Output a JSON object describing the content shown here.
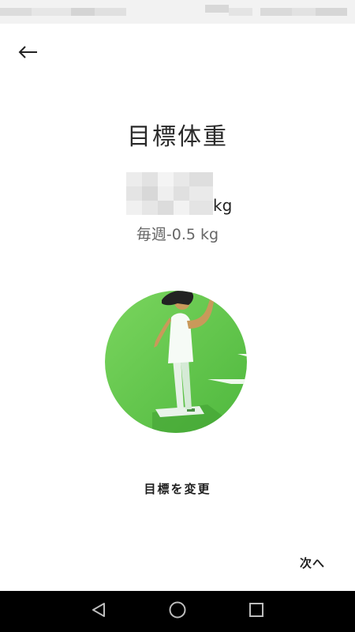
{
  "header": {
    "back_icon": "arrow-left-icon"
  },
  "main": {
    "title": "目標体重",
    "weight_value": "",
    "weight_unit": "kg",
    "weekly_rate": "毎週-0.5 kg",
    "illustration_icon": "woman-on-scale-illustration",
    "change_goal_label": "目標を変更",
    "next_label": "次へ"
  },
  "navigation": {
    "back_icon": "nav-back-triangle-icon",
    "home_icon": "nav-home-circle-icon",
    "recents_icon": "nav-recents-square-icon"
  },
  "colors": {
    "accent_green": "#5cc84a",
    "text_primary": "#222222",
    "text_secondary": "#666666",
    "nav_bar": "#000000"
  }
}
